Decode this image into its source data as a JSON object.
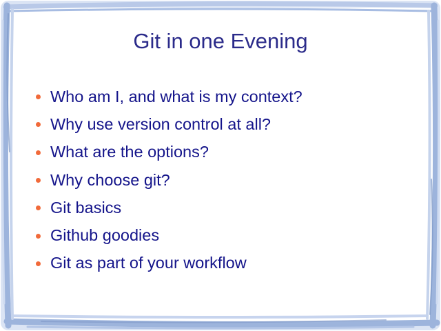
{
  "slide": {
    "title": "Git in one Evening",
    "bullets": [
      "Who am I, and what is my context?",
      "Why use version control at all?",
      "What are the options?",
      "Why choose git?",
      "Git basics",
      "Github goodies",
      "Git as part of your workflow"
    ]
  },
  "colors": {
    "title": "#2b2b8a",
    "text": "#14148a",
    "bullet": "#f16a3a",
    "frame_light": "#c5d3ec",
    "frame_mid": "#9db4dc",
    "frame_dark": "#7e98c8"
  }
}
